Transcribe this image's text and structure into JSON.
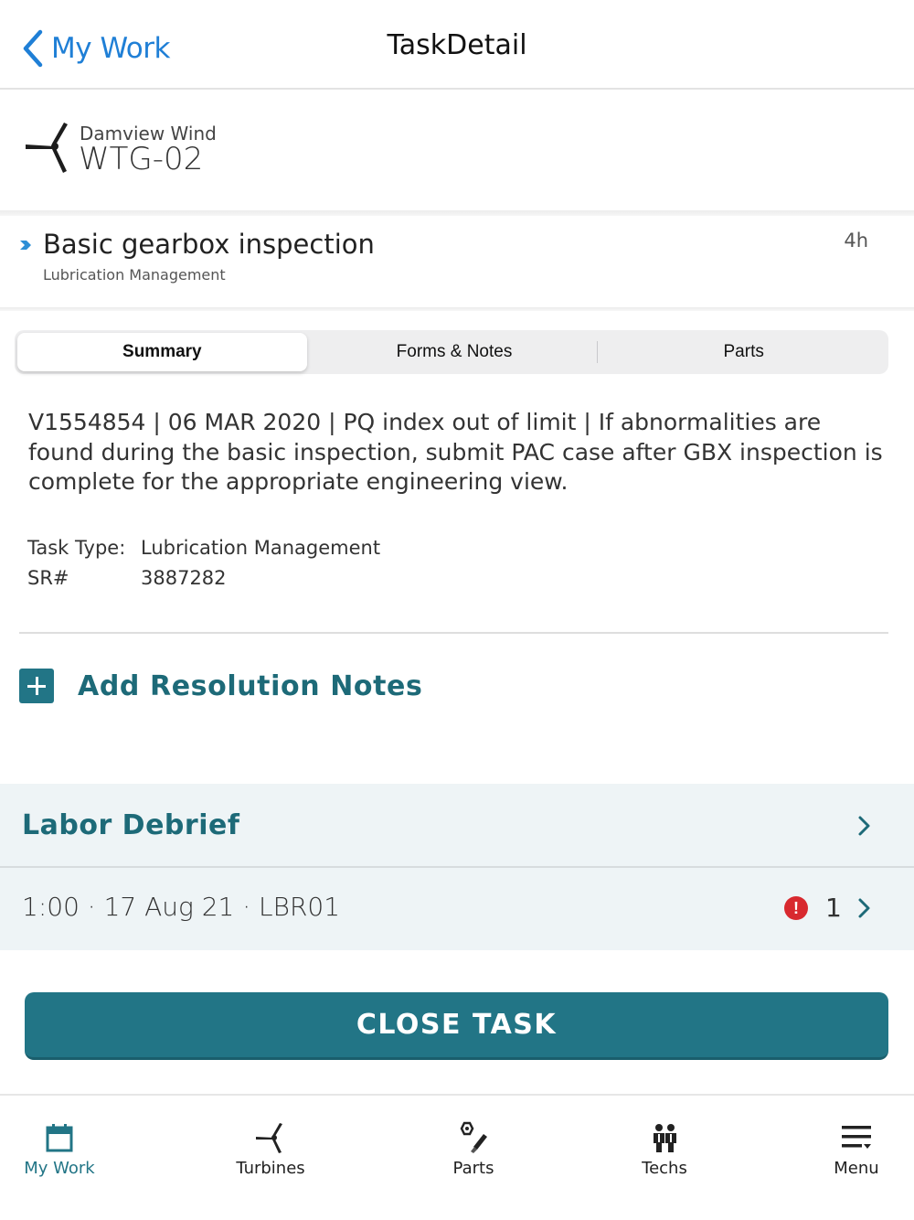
{
  "nav": {
    "back_label": "My Work",
    "title": "TaskDetail"
  },
  "asset": {
    "site": "Damview Wind",
    "name": "WTG-02",
    "icon": "turbine-icon"
  },
  "task": {
    "title": "Basic gearbox inspection",
    "category": "Lubrication Management",
    "duration": "4h"
  },
  "tabs": [
    {
      "label": "Summary",
      "active": true
    },
    {
      "label": "Forms & Notes",
      "active": false
    },
    {
      "label": "Parts",
      "active": false
    }
  ],
  "summary": {
    "description": "V1554854 | 06 MAR 2020 | PQ index out of limit | If abnormalities are found during the basic inspection, submit PAC case after GBX inspection is complete for the appropriate engineering view.",
    "fields": [
      {
        "label": "Task Type:",
        "value": "Lubrication Management"
      },
      {
        "label": "SR#",
        "value": "3887282"
      }
    ],
    "add_notes_label": "Add Resolution Notes"
  },
  "labor": {
    "title": "Labor Debrief",
    "entry": {
      "text": "1:00 · 17 Aug 21 · LBR01",
      "alert_count": "1",
      "alert_icon": "!"
    }
  },
  "close_button": "CLOSE TASK",
  "tabbar": [
    {
      "label": "My Work",
      "icon": "calendar-icon",
      "active": true
    },
    {
      "label": "Turbines",
      "icon": "turbine-icon",
      "active": false
    },
    {
      "label": "Parts",
      "icon": "parts-icon",
      "active": false
    },
    {
      "label": "Techs",
      "icon": "techs-icon",
      "active": false
    },
    {
      "label": "Menu",
      "icon": "menu-icon",
      "active": false
    }
  ],
  "colors": {
    "accent": "#227586",
    "link": "#1f7fd6",
    "alert": "#d8292f",
    "panel": "#eef4f6"
  }
}
